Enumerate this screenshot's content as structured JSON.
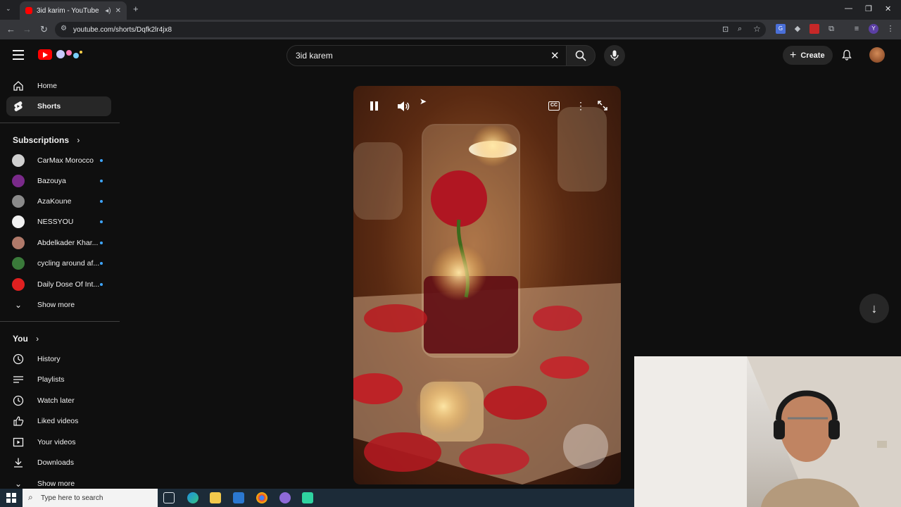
{
  "browser": {
    "tab_title": "3id karim - YouTube",
    "new_tab": "+",
    "url": "youtube.com/shorts/Dqfk2lr4jx8",
    "window_controls": [
      "—",
      "❐",
      "✕"
    ]
  },
  "header": {
    "search_value": "3id karem",
    "create_label": "Create"
  },
  "sidebar": {
    "main": [
      {
        "label": "Home",
        "icon": "home-icon"
      },
      {
        "label": "Shorts",
        "icon": "shorts-icon"
      }
    ],
    "subscriptions_title": "Subscriptions",
    "subscriptions": [
      {
        "label": "CarMax Morocco",
        "color": "#cfcfcf"
      },
      {
        "label": "Bazouya",
        "color": "#7a2a8a"
      },
      {
        "label": "AzaKoune",
        "color": "#8a8a8a"
      },
      {
        "label": "NESSYOU",
        "color": "#f1f1f1"
      },
      {
        "label": "Abdelkader Khar...",
        "color": "#b07a6a"
      },
      {
        "label": "cycling around af...",
        "color": "#3a7a3a"
      },
      {
        "label": "Daily Dose Of Int...",
        "color": "#e02020"
      }
    ],
    "show_more_1": "Show more",
    "you_title": "You",
    "you_items": [
      {
        "label": "History",
        "icon": "history-icon"
      },
      {
        "label": "Playlists",
        "icon": "playlists-icon"
      },
      {
        "label": "Watch later",
        "icon": "watch-later-icon"
      },
      {
        "label": "Liked videos",
        "icon": "like-icon"
      },
      {
        "label": "Your videos",
        "icon": "your-videos-icon"
      },
      {
        "label": "Downloads",
        "icon": "download-icon"
      }
    ],
    "show_more_2": "Show more"
  },
  "video": {
    "cc_label": "CC"
  },
  "taskbar": {
    "search_placeholder": "Type here to search"
  }
}
